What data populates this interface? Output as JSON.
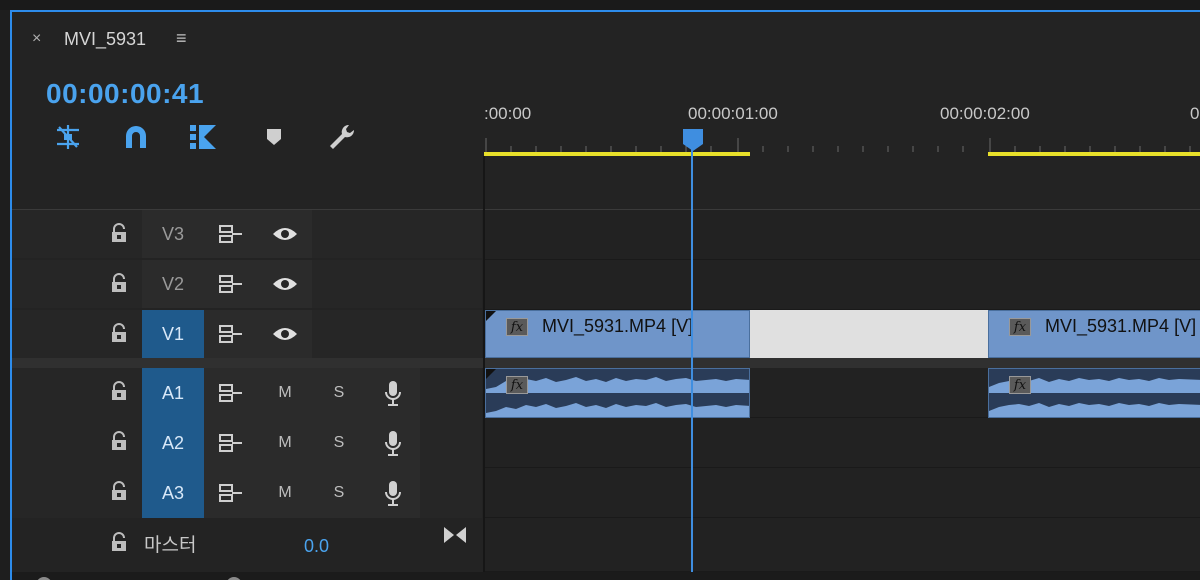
{
  "panel": {
    "close_glyph": "×",
    "title": "MVI_5931",
    "menu_glyph": "≡"
  },
  "timecode": "00:00:00:41",
  "toolbar": {
    "icons": [
      "insert-nest-icon",
      "snap-magnet-icon",
      "linked-selection-icon",
      "add-marker-icon",
      "wrench-settings-icon"
    ]
  },
  "ruler": {
    "labels": [
      ":00:00",
      "00:00:01:00",
      "00:00:02:00",
      "0"
    ]
  },
  "video_tracks": [
    {
      "name": "V3",
      "active": false
    },
    {
      "name": "V2",
      "active": false
    },
    {
      "name": "V1",
      "active": true
    }
  ],
  "audio_tracks": [
    {
      "name": "A1",
      "mute": "M",
      "solo": "S"
    },
    {
      "name": "A2",
      "mute": "M",
      "solo": "S"
    },
    {
      "name": "A3",
      "mute": "M",
      "solo": "S"
    }
  ],
  "master": {
    "label": "마스터",
    "value": "0.0"
  },
  "clips": {
    "video1": {
      "label": "MVI_5931.MP4 [V]",
      "fx": "fx"
    },
    "video2": {
      "label": "MVI_5931.MP4 [V]",
      "fx": "fx"
    },
    "audio1": {
      "fx": "fx"
    },
    "audio2": {
      "fx": "fx"
    }
  },
  "colors": {
    "accent": "#2d8ceb",
    "timecode": "#4aa3ee",
    "active_track": "#1f5a8c",
    "clip_video": "#6f95c9",
    "clip_audio": "#2a3c58",
    "work_area": "#e8e02a"
  }
}
